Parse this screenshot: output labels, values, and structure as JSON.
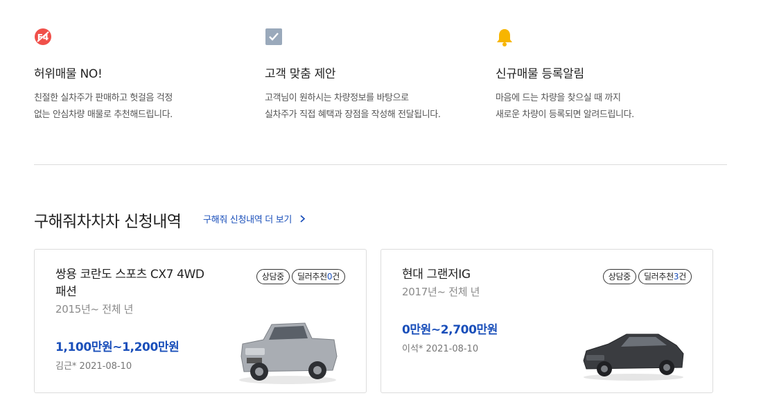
{
  "features": [
    {
      "icon": "no-fake-listing-icon",
      "title": "허위매물 NO!",
      "desc": [
        "친절한 실차주가 판매하고 헛걸음 걱정",
        "없는 안심차량 매물로 추천해드립니다."
      ]
    },
    {
      "icon": "checkbox-icon",
      "title": "고객 맞춤 제안",
      "desc": [
        "고객님이 원하시는 차량정보를 바탕으로",
        "실차주가 직접 혜택과 장점을 작성해 전달됩니다."
      ]
    },
    {
      "icon": "bell-icon",
      "title": "신규매물 등록알림",
      "desc": [
        "마음에 드는 차량을 찾으실 때 까지",
        "새로운 차량이 등록되면 알려드립니다."
      ]
    }
  ],
  "section": {
    "title": "구해줘차차차 신청내역",
    "more_link": "구해줘 신청내역 더 보기"
  },
  "cards": [
    {
      "name": "쌍용 코란도 스포츠 CX7 4WD 패션",
      "year": "2015년~ 전체 년",
      "status": "상담중",
      "dealer_label": "딜러추천",
      "dealer_count": "0",
      "dealer_unit": "건",
      "price": "1,100만원~1,200만원",
      "requester": "김근* 2021-08-10",
      "car_color": "#a9adb3"
    },
    {
      "name": "현대 그랜저IG",
      "year": "2017년~ 전체 년",
      "status": "상담중",
      "dealer_label": "딜러추천",
      "dealer_count": "3",
      "dealer_unit": "건",
      "price": "0만원~2,700만원",
      "requester": "이석* 2021-08-10",
      "car_color": "#3a3c40"
    }
  ],
  "colors": {
    "accent": "#1a4fba",
    "red": "#f0504a",
    "check": "#9aa9bb",
    "bell": "#f7b500"
  }
}
